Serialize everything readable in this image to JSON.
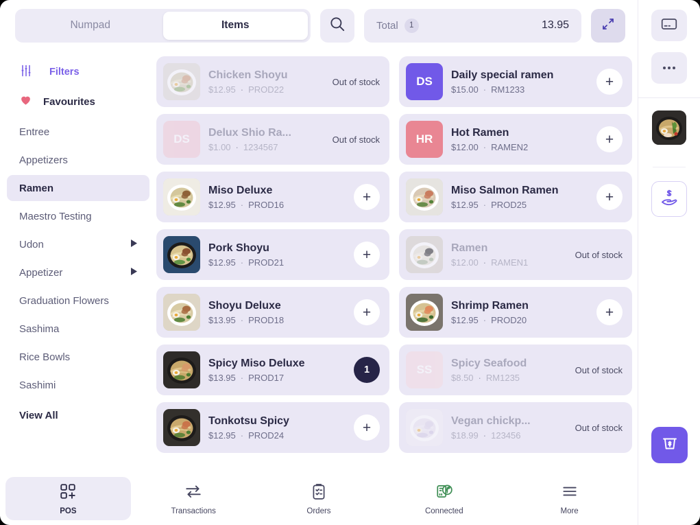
{
  "topbar": {
    "tabs": [
      {
        "label": "Numpad",
        "active": false
      },
      {
        "label": "Items",
        "active": true
      }
    ],
    "search_icon": "search-icon",
    "total_label": "Total",
    "total_count": "1",
    "total_amount": "13.95",
    "expand_icon": "expand-collapse-icon"
  },
  "sidebar": {
    "filters_label": "Filters",
    "filters_icon": "sliders-icon",
    "favourites_label": "Favourites",
    "favourites_icon": "heart-icon",
    "categories": [
      {
        "label": "Entree",
        "active": false,
        "expandable": false
      },
      {
        "label": "Appetizers",
        "active": false,
        "expandable": false
      },
      {
        "label": "Ramen",
        "active": true,
        "expandable": false
      },
      {
        "label": "Maestro Testing",
        "active": false,
        "expandable": false
      },
      {
        "label": "Udon",
        "active": false,
        "expandable": true
      },
      {
        "label": "Appetizer",
        "active": false,
        "expandable": true
      },
      {
        "label": "Graduation Flowers",
        "active": false,
        "expandable": false
      },
      {
        "label": "Sashima",
        "active": false,
        "expandable": false
      },
      {
        "label": "Rice Bowls",
        "active": false,
        "expandable": false
      },
      {
        "label": "Sashimi",
        "active": false,
        "expandable": false
      }
    ],
    "view_all_label": "View All"
  },
  "products": {
    "out_of_stock_label": "Out of stock",
    "add_label": "+",
    "items": [
      {
        "name": "Chicken Shoyu",
        "price": "$12.95",
        "sku": "PROD22",
        "state": "out_of_stock",
        "thumb_type": "photo",
        "thumb_variant": "shoyu"
      },
      {
        "name": "Daily special ramen",
        "price": "$15.00",
        "sku": "RM1233",
        "state": "available",
        "thumb_type": "initials",
        "initials": "DS",
        "thumb_color": "#7159E8"
      },
      {
        "name": "Delux Shio Ra...",
        "price": "$1.00",
        "sku": "1234567",
        "state": "out_of_stock",
        "thumb_type": "initials",
        "initials": "DS",
        "thumb_color": "#F2C3CE"
      },
      {
        "name": "Hot Ramen",
        "price": "$12.00",
        "sku": "RAMEN2",
        "state": "available",
        "thumb_type": "initials",
        "initials": "HR",
        "thumb_color": "#E98693"
      },
      {
        "name": "Miso Deluxe",
        "price": "$12.95",
        "sku": "PROD16",
        "state": "available",
        "thumb_type": "photo",
        "thumb_variant": "miso"
      },
      {
        "name": "Miso Salmon Ramen",
        "price": "$12.95",
        "sku": "PROD25",
        "state": "available",
        "thumb_type": "photo",
        "thumb_variant": "salmon"
      },
      {
        "name": "Pork Shoyu",
        "price": "$12.95",
        "sku": "PROD21",
        "state": "available",
        "thumb_type": "photo",
        "thumb_variant": "pork"
      },
      {
        "name": "Ramen",
        "price": "$12.00",
        "sku": "RAMEN1",
        "state": "out_of_stock",
        "thumb_type": "photo",
        "thumb_variant": "plain"
      },
      {
        "name": "Shoyu Deluxe",
        "price": "$13.95",
        "sku": "PROD18",
        "state": "available",
        "thumb_type": "photo",
        "thumb_variant": "shoyudx"
      },
      {
        "name": "Shrimp Ramen",
        "price": "$12.95",
        "sku": "PROD20",
        "state": "available",
        "thumb_type": "photo",
        "thumb_variant": "shrimp"
      },
      {
        "name": "Spicy Miso Deluxe",
        "price": "$13.95",
        "sku": "PROD17",
        "state": "in_cart",
        "quantity": "1",
        "thumb_type": "photo",
        "thumb_variant": "spicymiso"
      },
      {
        "name": "Spicy Seafood",
        "price": "$8.50",
        "sku": "RM1235",
        "state": "out_of_stock",
        "thumb_type": "initials",
        "initials": "SS",
        "thumb_color": "#F6D6DE"
      },
      {
        "name": "Tonkotsu Spicy",
        "price": "$12.95",
        "sku": "PROD24",
        "state": "available",
        "thumb_type": "photo",
        "thumb_variant": "tonkotsu"
      },
      {
        "name": "Vegan chickp...",
        "price": "$18.99",
        "sku": "123456",
        "state": "out_of_stock",
        "thumb_type": "photo",
        "thumb_variant": "vegan"
      }
    ]
  },
  "bottomnav": {
    "items": [
      {
        "label": "POS",
        "icon": "pos-grid-icon",
        "active": true
      },
      {
        "label": "Transactions",
        "icon": "transfer-arrows-icon",
        "active": false
      },
      {
        "label": "Orders",
        "icon": "clipboard-icon",
        "active": false
      },
      {
        "label": "Connected",
        "icon": "usb-connected-icon",
        "active": false
      },
      {
        "label": "More",
        "icon": "hamburger-menu-icon",
        "active": false
      }
    ]
  },
  "rightpanel": {
    "card_reader_icon": "card-reader-icon",
    "more_icon": "more-dots-icon",
    "cart_thumb_icon": "cart-item-thumbnail",
    "pay_icon": "hand-cash-icon",
    "cash_icon": "cash-drawer-icon"
  },
  "colors": {
    "accent": "#7159E8",
    "card_bg": "#EAE7F5",
    "chip_bg": "#EDEBF6",
    "text_dark": "#2B2A45",
    "badge_dark": "#262447",
    "connected_green": "#3E8E54",
    "heart_pink": "#E8677E"
  }
}
